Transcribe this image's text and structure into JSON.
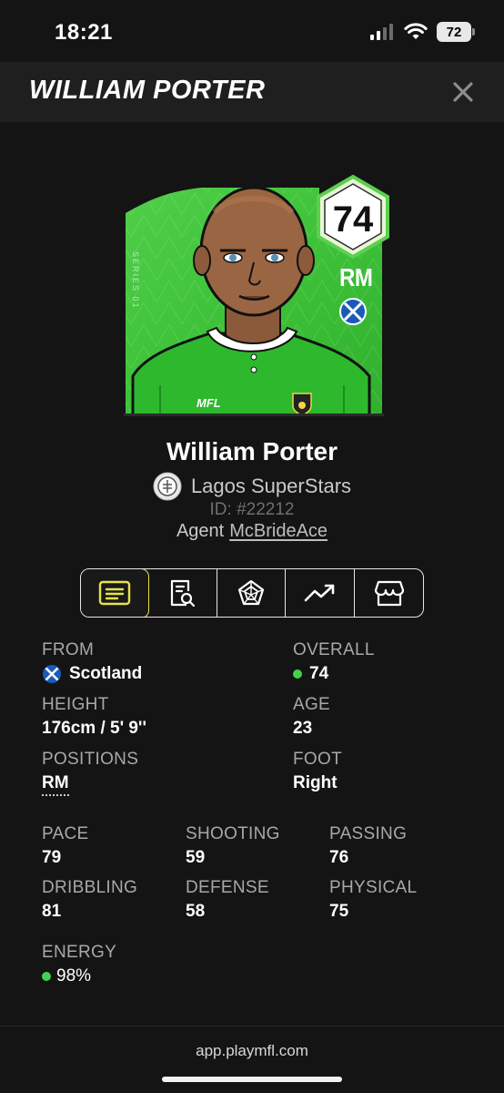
{
  "status_bar": {
    "time": "18:21",
    "battery": "72"
  },
  "header": {
    "title": "WILLIAM PORTER"
  },
  "card": {
    "rating": "74",
    "position": "RM",
    "brand": "MFL",
    "series": "SERIES 01"
  },
  "player": {
    "name": "William Porter",
    "club": "Lagos SuperStars",
    "id": "ID: #22212",
    "agent_label": "Agent",
    "agent_name": "McBrideAce"
  },
  "tabs": [
    {
      "name": "info",
      "icon": "document-lines-icon",
      "active": true
    },
    {
      "name": "report",
      "icon": "report-search-icon",
      "active": false
    },
    {
      "name": "attributes",
      "icon": "pentagon-radar-icon",
      "active": false
    },
    {
      "name": "progression",
      "icon": "trend-up-icon",
      "active": false
    },
    {
      "name": "market",
      "icon": "store-icon",
      "active": false
    }
  ],
  "details": {
    "from": {
      "label": "FROM",
      "value": "Scotland"
    },
    "overall": {
      "label": "OVERALL",
      "value": "74"
    },
    "height": {
      "label": "HEIGHT",
      "value": "176cm / 5' 9''"
    },
    "age": {
      "label": "AGE",
      "value": "23"
    },
    "positions": {
      "label": "POSITIONS",
      "value": "RM"
    },
    "foot": {
      "label": "FOOT",
      "value": "Right"
    }
  },
  "stats": {
    "pace": {
      "label": "PACE",
      "value": "79"
    },
    "shooting": {
      "label": "SHOOTING",
      "value": "59"
    },
    "passing": {
      "label": "PASSING",
      "value": "76"
    },
    "dribbling": {
      "label": "DRIBBLING",
      "value": "81"
    },
    "defense": {
      "label": "DEFENSE",
      "value": "58"
    },
    "physical": {
      "label": "PHYSICAL",
      "value": "75"
    },
    "energy": {
      "label": "ENERGY",
      "value": "98%"
    }
  },
  "footer": {
    "url": "app.playmfl.com"
  },
  "colors": {
    "card_green": "#3fc23a",
    "accent_yellow": "#e8e24a",
    "status_green": "#45d14d",
    "background": "#141414"
  }
}
